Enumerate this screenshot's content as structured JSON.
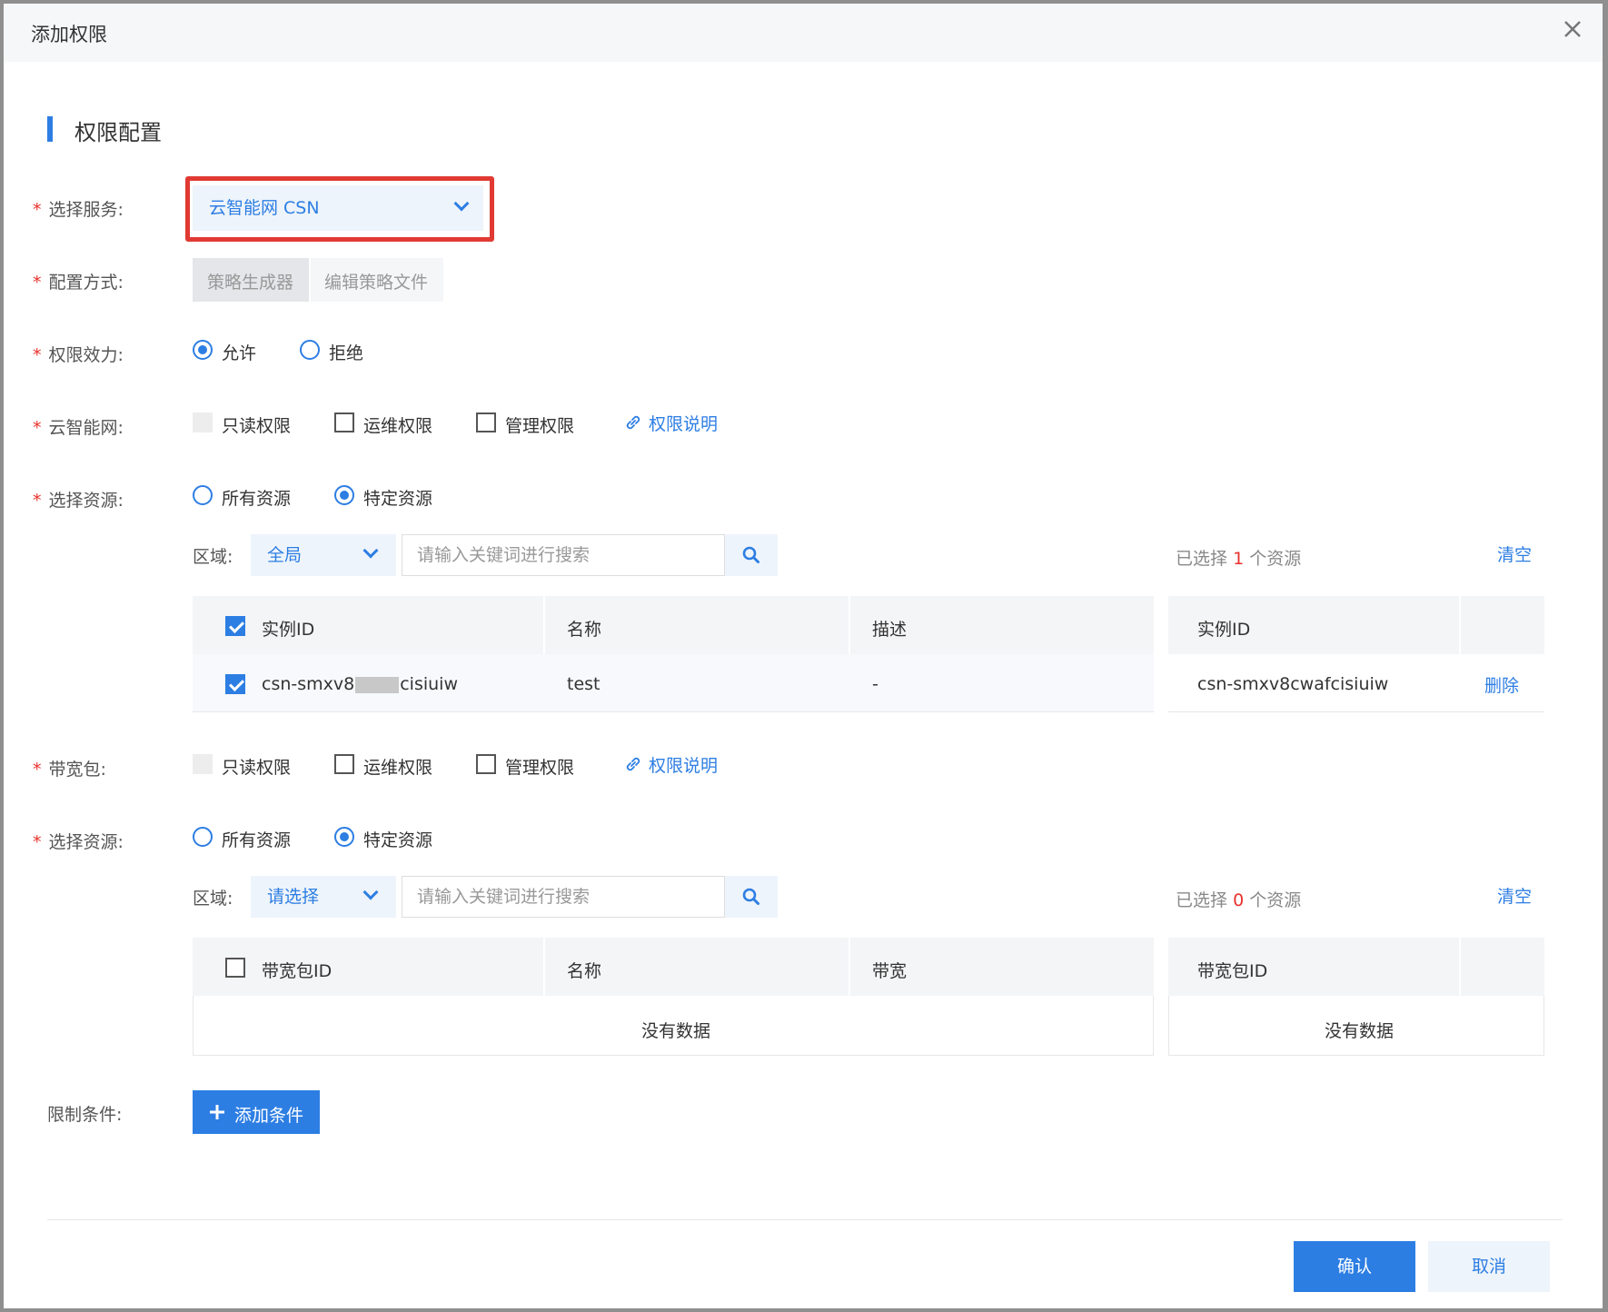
{
  "dialog": {
    "title": "添加权限"
  },
  "section": {
    "title": "权限配置"
  },
  "service": {
    "label": "选择服务:",
    "value": "云智能网 CSN"
  },
  "config_mode": {
    "label": "配置方式:",
    "tabs": [
      "策略生成器",
      "编辑策略文件"
    ]
  },
  "effect": {
    "label": "权限效力:",
    "options": [
      "允许",
      "拒绝"
    ],
    "selected": "允许"
  },
  "csn": {
    "label": "云智能网:",
    "perms": [
      "只读权限",
      "运维权限",
      "管理权限"
    ],
    "doc_link": "权限说明",
    "resource_label": "选择资源:",
    "resource_options": [
      "所有资源",
      "特定资源"
    ],
    "region_label": "区域:",
    "region_value": "全局",
    "search_placeholder": "请输入关键词进行搜索",
    "selected_prefix": "已选择",
    "selected_count": "1",
    "selected_suffix": "个资源",
    "clear": "清空",
    "columns": [
      "实例ID",
      "名称",
      "描述"
    ],
    "rows": [
      {
        "id": "csn-smxv8",
        "id_tail": "cisiuiw",
        "name": "test",
        "desc": "-"
      }
    ],
    "right_column": "实例ID",
    "right_rows": [
      {
        "id": "csn-smxv8cwafcisiuiw",
        "action": "删除"
      }
    ]
  },
  "bwp": {
    "label": "带宽包:",
    "perms": [
      "只读权限",
      "运维权限",
      "管理权限"
    ],
    "doc_link": "权限说明",
    "resource_label": "选择资源:",
    "resource_options": [
      "所有资源",
      "特定资源"
    ],
    "region_label": "区域:",
    "region_value": "请选择",
    "search_placeholder": "请输入关键词进行搜索",
    "selected_prefix": "已选择",
    "selected_count": "0",
    "selected_suffix": "个资源",
    "clear": "清空",
    "columns": [
      "带宽包ID",
      "名称",
      "带宽"
    ],
    "empty": "没有数据",
    "right_column": "带宽包ID",
    "right_empty": "没有数据"
  },
  "conditions": {
    "label": "限制条件:",
    "add_button": "添加条件"
  },
  "footer": {
    "confirm": "确认",
    "cancel": "取消"
  },
  "colors": {
    "accent": "#2d7ee3",
    "required": "#e8312c",
    "highlight": "#e03a33"
  }
}
